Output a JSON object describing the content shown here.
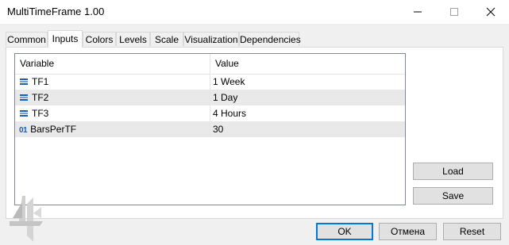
{
  "window": {
    "title": "MultiTimeFrame 1.00"
  },
  "tabs": [
    {
      "label": "Common"
    },
    {
      "label": "Inputs"
    },
    {
      "label": "Colors"
    },
    {
      "label": "Levels"
    },
    {
      "label": "Scale"
    },
    {
      "label": "Visualization"
    },
    {
      "label": "Dependencies"
    }
  ],
  "table": {
    "headers": {
      "variable": "Variable",
      "value": "Value"
    },
    "rows": [
      {
        "icon": "enum-icon",
        "variable": "TF1",
        "value": "1 Week"
      },
      {
        "icon": "enum-icon",
        "variable": "TF2",
        "value": "1 Day"
      },
      {
        "icon": "enum-icon",
        "variable": "TF3",
        "value": "4 Hours"
      },
      {
        "icon": "integer-icon",
        "icon_text": "01",
        "variable": "BarsPerTF",
        "value": "30"
      }
    ]
  },
  "buttons": {
    "load": "Load",
    "save": "Save",
    "ok": "OK",
    "cancel": "Отмена",
    "reset": "Reset"
  },
  "colors": {
    "accent": "#0078d7",
    "alt_row": "#e9e9e9"
  }
}
